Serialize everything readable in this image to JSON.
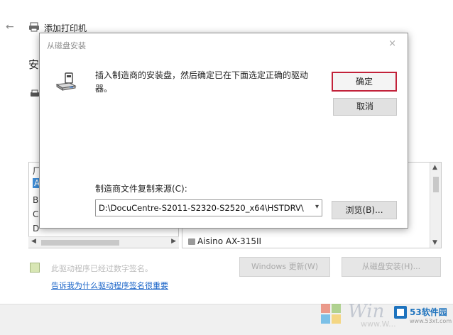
{
  "wizard": {
    "back_glyph": "←",
    "title": "添加打印机",
    "heading": "安",
    "left_list_items": [
      "厂",
      "A",
      "B",
      "C",
      "D"
    ],
    "printer_item": "Aisino AX-315II",
    "signed_text": "此驱动程序已经过数字签名。",
    "windows_update_label": "Windows 更新(W)",
    "have_disk_label": "从磁盘安装(H)...",
    "sig_link": "告诉我为什么驱动程序签名很重要"
  },
  "dialog": {
    "title": "从磁盘安装",
    "close_glyph": "×",
    "message": "插入制造商的安装盘，然后确定已在下面选定正确的驱动器。",
    "ok_label": "确定",
    "cancel_label": "取消",
    "source_label": "制造商文件复制来源(C):",
    "source_value": "D:\\DocuCentre-S2011-S2320-S2520_x64\\HSTDRV\\",
    "browse_label": "浏览(B)..."
  },
  "watermark": {
    "site_name": "53软件园",
    "site_url": "www.53xt.com",
    "win_text": "Win",
    "win_url": "www.W..."
  },
  "icons": {
    "back": "back-arrow-icon",
    "printer": "printer-icon",
    "disk": "disk-drive-icon",
    "close": "close-icon",
    "dropdown": "chevron-down-icon"
  }
}
